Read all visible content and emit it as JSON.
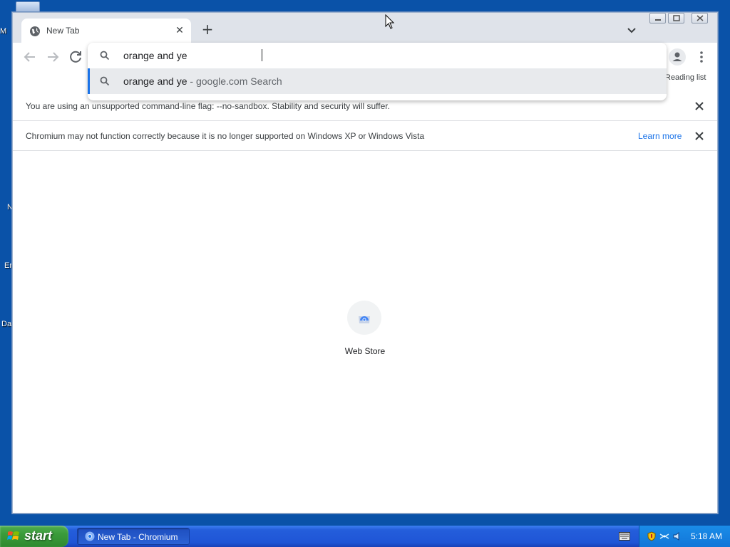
{
  "desktop": {
    "icon_labels": [
      "M",
      "N",
      "Er",
      "Da"
    ]
  },
  "browser": {
    "tab": {
      "title": "New Tab"
    },
    "omnibox": {
      "value": "orange and ye",
      "suggestion_query": "orange and ye",
      "suggestion_separator": " - ",
      "suggestion_source": "google.com Search"
    },
    "reading_list_label": "Reading list",
    "infobars": [
      {
        "text": "You are using an unsupported command-line flag: --no-sandbox. Stability and security will suffer."
      },
      {
        "text": "Chromium may not function correctly because it is no longer supported on Windows XP or Windows Vista",
        "link": "Learn more"
      }
    ],
    "shortcut": {
      "label": "Web Store"
    }
  },
  "taskbar": {
    "start_label": "start",
    "task_label": "New Tab - Chromium",
    "clock": "5:18 AM"
  },
  "colors": {
    "accent": "#1a73e8",
    "desktop": "#0a52a8",
    "start_green": "#3a9b3a",
    "taskbar_blue": "#245edb"
  }
}
